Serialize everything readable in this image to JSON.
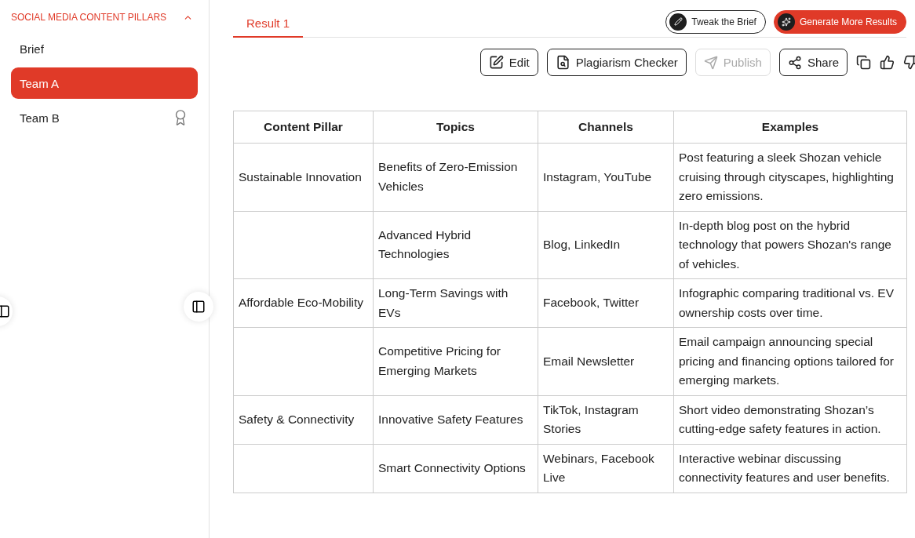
{
  "sidebar": {
    "section": {
      "title": "SOCIAL MEDIA CONTENT PILLARS",
      "expanded": true
    },
    "items": [
      {
        "label": "Brief",
        "selected": false,
        "kind": "plain"
      },
      {
        "label": "Team A",
        "selected": true,
        "kind": "plain"
      },
      {
        "label": "Team B",
        "selected": false,
        "kind": "award"
      }
    ]
  },
  "tabs": [
    {
      "label": "Result 1",
      "selected": true
    }
  ],
  "top_buttons": [
    {
      "label": "Tweak the Brief",
      "kind": "outline"
    },
    {
      "label": "Generate More Results",
      "kind": "primary"
    }
  ],
  "actions": [
    {
      "label": "Edit",
      "kind": "edit",
      "disabled": false
    },
    {
      "label": "Plagiarism Checker",
      "kind": "plagiarism",
      "disabled": false
    },
    {
      "label": "Publish",
      "kind": "publish",
      "disabled": true
    },
    {
      "label": "Share",
      "kind": "share",
      "disabled": false
    }
  ],
  "table": {
    "columns": [
      "Content Pillar",
      "Topics",
      "Channels",
      "Examples"
    ],
    "rows": [
      {
        "pillar": "Sustainable Innovation",
        "topic": "Benefits of Zero-Emission Vehicles",
        "channels": "Instagram, YouTube",
        "example": "Post featuring a sleek Shozan vehicle cruising through cityscapes, highlighting zero emissions."
      },
      {
        "topic": "Advanced Hybrid Technologies",
        "channels": "Blog, LinkedIn",
        "example": "In-depth blog post on the hybrid technology that powers Shozan's range of vehicles."
      },
      {
        "pillar": "Affordable Eco-Mobility",
        "topic": "Long-Term Savings with EVs",
        "channels": "Facebook, Twitter",
        "example": "Infographic comparing traditional vs. EV ownership costs over time."
      },
      {
        "topic": "Competitive Pricing for Emerging Markets",
        "channels": "Email Newsletter",
        "example": "Email campaign announcing special pricing and financing options tailored for emerging markets."
      },
      {
        "pillar": "Safety & Connectivity",
        "topic": "Innovative Safety Features",
        "channels": "TikTok, Instagram Stories",
        "example": "Short video demonstrating Shozan’s cutting-edge safety features in action."
      },
      {
        "topic": "Smart Connectivity Options",
        "channels": "Webinars, Facebook Live",
        "example": "Interactive webinar discussing connectivity features and user benefits."
      }
    ]
  }
}
